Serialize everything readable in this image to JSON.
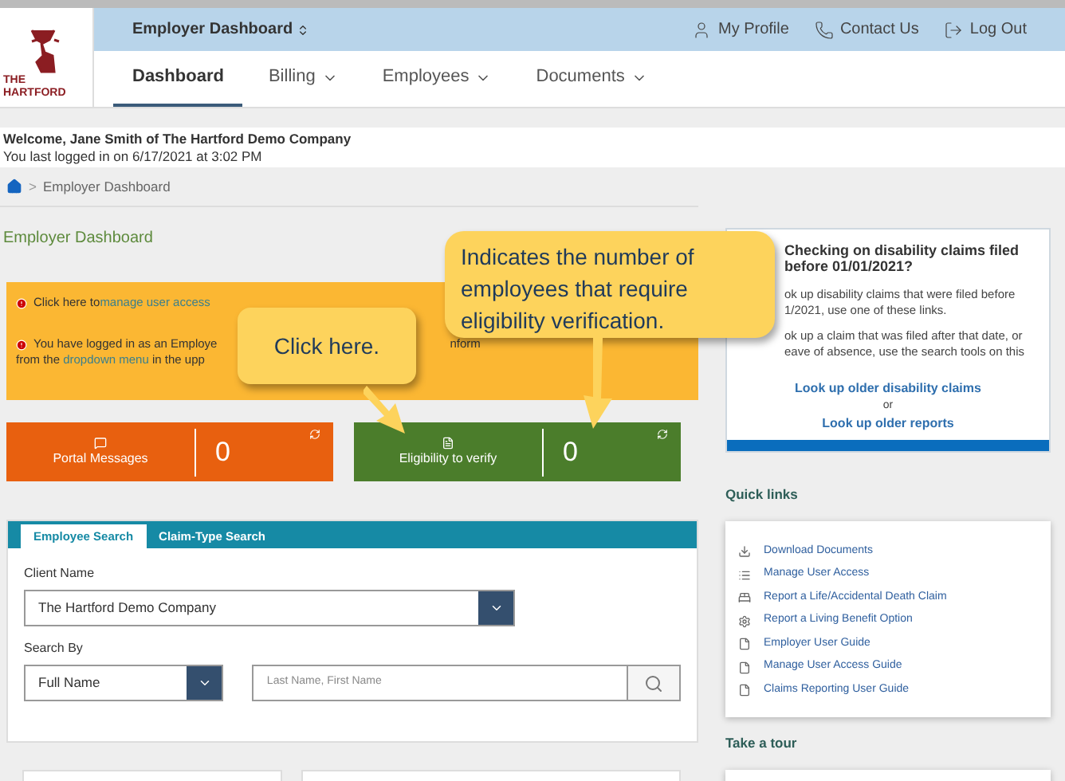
{
  "logo": {
    "lines": [
      "THE",
      "HARTFORD"
    ]
  },
  "top_bar": {
    "title": "Employer Dashboard",
    "links": [
      {
        "kind": "profile",
        "label": "My Profile"
      },
      {
        "kind": "contact",
        "label": "Contact Us"
      },
      {
        "kind": "logout",
        "label": "Log Out"
      }
    ]
  },
  "nav": [
    {
      "label": "Dashboard",
      "selected": true,
      "dropdown": false
    },
    {
      "label": "Billing",
      "selected": false,
      "dropdown": true
    },
    {
      "label": "Employees",
      "selected": false,
      "dropdown": true
    },
    {
      "label": "Documents",
      "selected": false,
      "dropdown": true
    }
  ],
  "welcome": {
    "greeting": "Welcome, Jane Smith of The Hartford Demo Company",
    "last_login": "You last logged in on 6/17/2021 at 3:02 PM"
  },
  "breadcrumb": {
    "separator": ">",
    "items": [
      "Employer Dashboard"
    ]
  },
  "page_title": "Employer Dashboard",
  "alerts": {
    "line_1": {
      "text": "Click here to ",
      "link": "manage user access"
    },
    "line_2": {
      "start": "You have logged in as an Employe",
      "end": "nform"
    },
    "line_3": {
      "text": "from the ",
      "link": "dropdown menu",
      "end": " in the upp"
    }
  },
  "tiles": [
    {
      "kind": "messages",
      "label": "Portal Messages",
      "count": "0",
      "color": "#e8600f"
    },
    {
      "kind": "eligibility",
      "label": "Eligibility to verify",
      "count": "0",
      "color": "#4b7d2b"
    }
  ],
  "callouts": [
    {
      "text": "Click here."
    },
    {
      "text": "Indicates the number of employees that require eligibility verification."
    }
  ],
  "search": {
    "tabs": [
      {
        "label": "Employee Search",
        "selected": true
      },
      {
        "label": "Claim-Type Search",
        "selected": false
      }
    ],
    "client_label": "Client Name",
    "client_value": "The Hartford Demo Company",
    "search_by_label": "Search By",
    "search_by_value": "Full Name",
    "placeholder": "Last Name, First Name"
  },
  "info_box": {
    "title": "Checking on disability claims filed before 01/01/2021?",
    "para_1": [
      "ok up disability claims that were filed before",
      "1/2021, use one of these links."
    ],
    "para_2": [
      "ok up a claim that was filed after that date, or",
      "eave of absence, use the search tools on this"
    ],
    "link_1": "Look up older disability claims",
    "or": "or",
    "link_2": "Look up older reports"
  },
  "quick_links": {
    "title": "Quick links",
    "items": [
      {
        "kind": "download",
        "label": "Download Documents"
      },
      {
        "kind": "list",
        "label": "Manage User Access"
      },
      {
        "kind": "bed",
        "label": "Report a Life/Accidental Death Claim"
      },
      {
        "kind": "gear",
        "label": "Report a Living Benefit Option"
      },
      {
        "kind": "doc",
        "label": "Employer User Guide"
      },
      {
        "kind": "doc",
        "label": "Manage User Access Guide"
      },
      {
        "kind": "doc",
        "label": "Claims Reporting User Guide"
      }
    ]
  },
  "tour": {
    "title": "Take a tour"
  }
}
